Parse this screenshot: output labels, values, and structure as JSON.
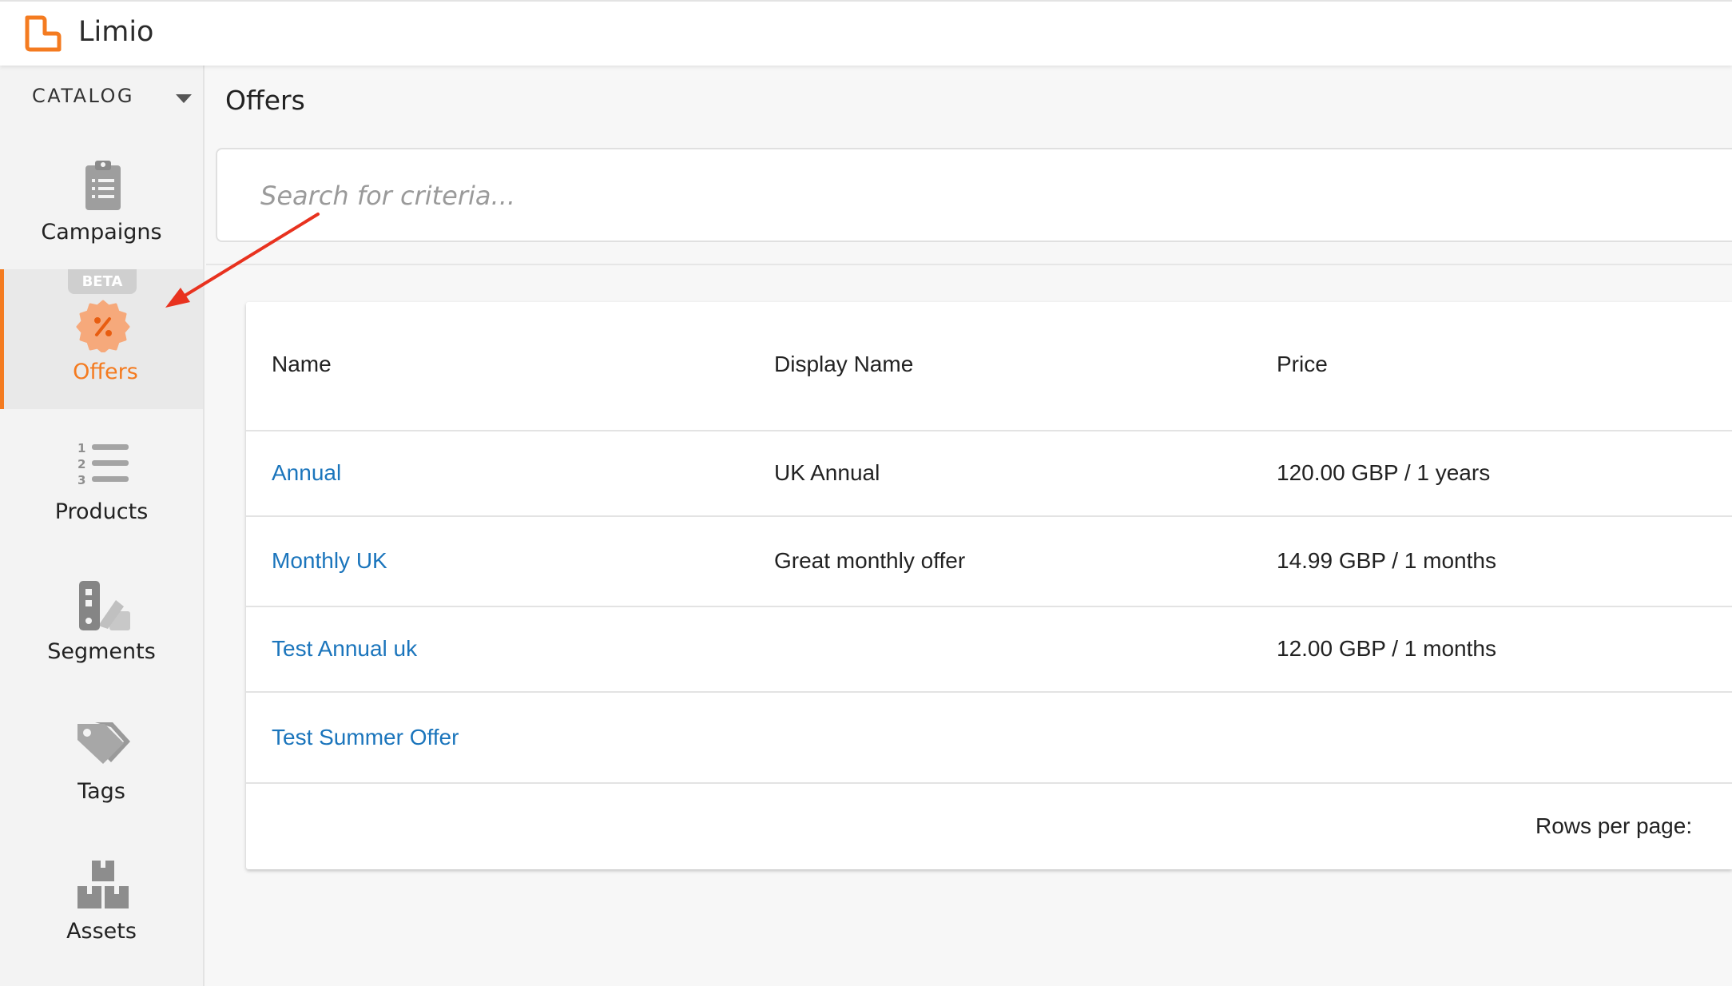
{
  "app": {
    "brand": "Limio",
    "logo_icon": "limio-logo-icon",
    "accent": "#f47b20",
    "link_color": "#1b75bc"
  },
  "sidebar": {
    "section_label": "CATALOG",
    "items": [
      {
        "label": "Campaigns",
        "icon": "clipboard-list-icon"
      },
      {
        "label": "Offers",
        "icon": "percent-badge-icon",
        "badge": "BETA",
        "active": true
      },
      {
        "label": "Products",
        "icon": "numbered-list-icon"
      },
      {
        "label": "Segments",
        "icon": "segments-swatch-icon"
      },
      {
        "label": "Tags",
        "icon": "tags-icon"
      },
      {
        "label": "Assets",
        "icon": "boxes-icon"
      }
    ]
  },
  "main": {
    "title": "Offers",
    "search": {
      "placeholder": "Search for criteria..."
    },
    "table": {
      "columns": [
        "Name",
        "Display Name",
        "Price"
      ],
      "rows": [
        {
          "name": "Annual",
          "display_name": "UK Annual",
          "price": "120.00 GBP / 1 years"
        },
        {
          "name": "Monthly UK",
          "display_name": "Great monthly offer",
          "price": "14.99 GBP / 1 months"
        },
        {
          "name": "Test Annual uk",
          "display_name": "",
          "price": "12.00 GBP / 1 months"
        },
        {
          "name": "Test Summer Offer",
          "display_name": "",
          "price": ""
        }
      ],
      "rows_per_page_label": "Rows per page:"
    }
  }
}
